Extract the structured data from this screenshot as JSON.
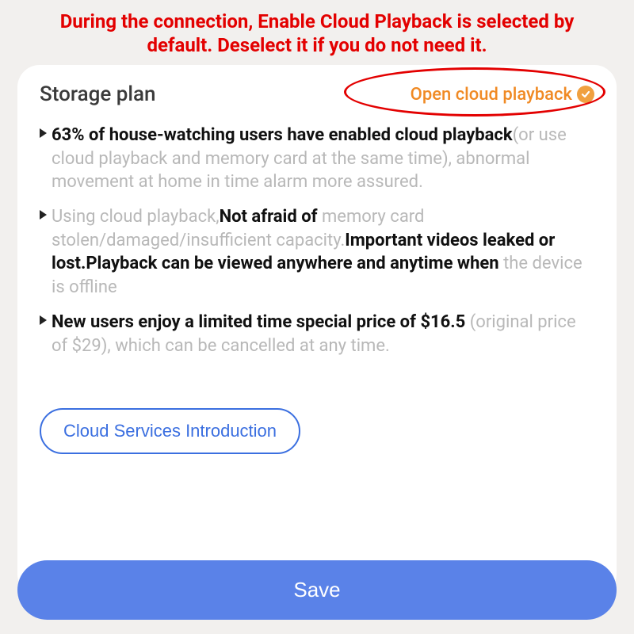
{
  "annotation": "During the connection, Enable Cloud Playback is selected by default. Deselect it if you do not need it.",
  "header": {
    "title": "Storage plan",
    "toggle_label": "Open cloud playback"
  },
  "bullets": {
    "b1": {
      "s1": "63% of house-watching users have enabled cloud playback",
      "s2": "(or use cloud playback and memory card at the same time), abnormal movement at home in time alarm more assured."
    },
    "b2": {
      "s1": "Using cloud playback,",
      "s2": "Not afraid of",
      "s3": " memory card stolen/damaged/insufficient capacity.",
      "s4": "Important videos leaked or lost.Playback can be viewed anywhere and anytime when",
      "s5": " the device is offline"
    },
    "b3": {
      "s1": "New users enjoy a limited time special price of $16.5",
      "s2": " (original price of $29), which can be cancelled at any time."
    }
  },
  "buttons": {
    "intro": "Cloud Services Introduction",
    "save": "Save"
  }
}
